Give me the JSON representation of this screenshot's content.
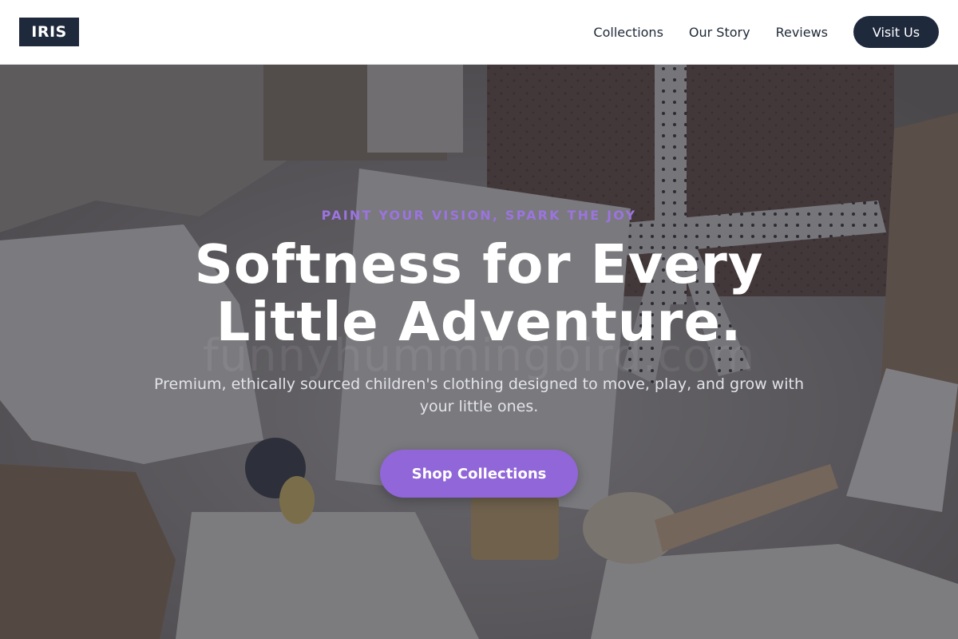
{
  "brand": {
    "logo_text": "IRIS"
  },
  "nav": {
    "links": [
      {
        "label": "Collections"
      },
      {
        "label": "Our Story"
      },
      {
        "label": "Reviews"
      }
    ],
    "cta_label": "Visit Us"
  },
  "hero": {
    "eyebrow": "PAINT YOUR VISION, SPARK THE JOY",
    "headline_line1": "Softness for Every",
    "headline_line2": "Little Adventure.",
    "subtitle": "Premium, ethically sourced children's clothing designed to move, play, and grow with your little ones.",
    "cta_label": "Shop Collections",
    "watermark": "funnyhummingbird.com"
  },
  "colors": {
    "brand_dark": "#1e293b",
    "accent_purple": "#9066d8",
    "eyebrow_purple": "#9b74e0"
  }
}
